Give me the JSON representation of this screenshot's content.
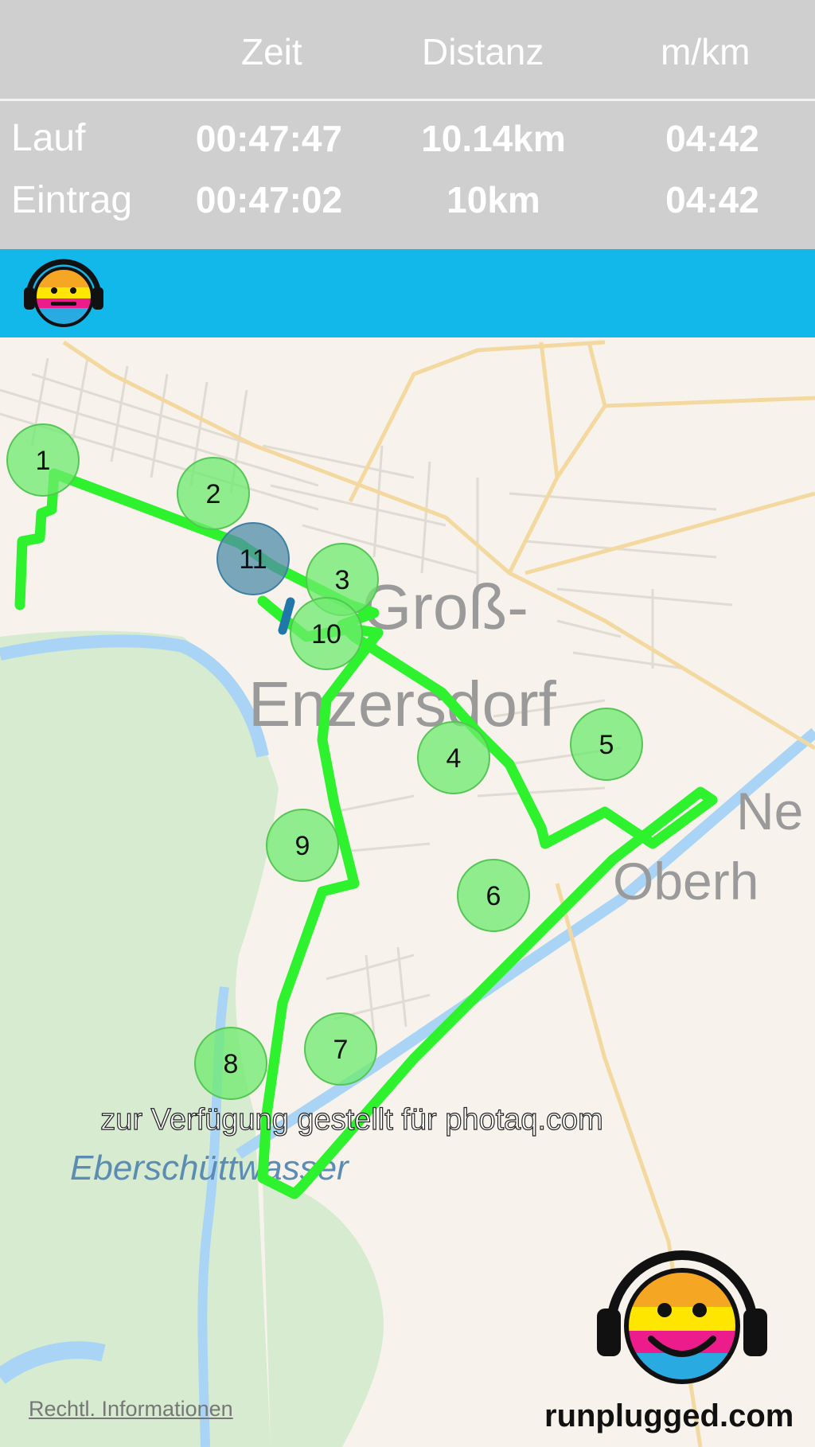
{
  "header": {
    "columns": [
      "Zeit",
      "Distanz",
      "m/km"
    ],
    "rows": [
      {
        "label": "Lauf",
        "time": "00:47:47",
        "distance": "10.14km",
        "pace": "04:42"
      },
      {
        "label": "Eintrag",
        "time": "00:47:02",
        "distance": "10km",
        "pace": "04:42"
      }
    ]
  },
  "toolbar": {
    "logo_icon": "runplugged-smiley-headphones-icon",
    "color": "#13b8ea"
  },
  "map": {
    "labels": {
      "town_line1": "Groß-",
      "town_line2": "Enzersdorf",
      "east_line1": "Ne",
      "east_line2": "Oberh",
      "water": "Eberschüttwasser"
    },
    "route_color": "#2df22d",
    "markers": [
      "1",
      "2",
      "3",
      "4",
      "5",
      "6",
      "7",
      "8",
      "9",
      "10",
      "11"
    ],
    "current_marker": "11"
  },
  "watermark": "zur Verfügung gestellt für photaq.com",
  "legal_link": "Rechtl. Informationen",
  "brand": "runplugged.com"
}
